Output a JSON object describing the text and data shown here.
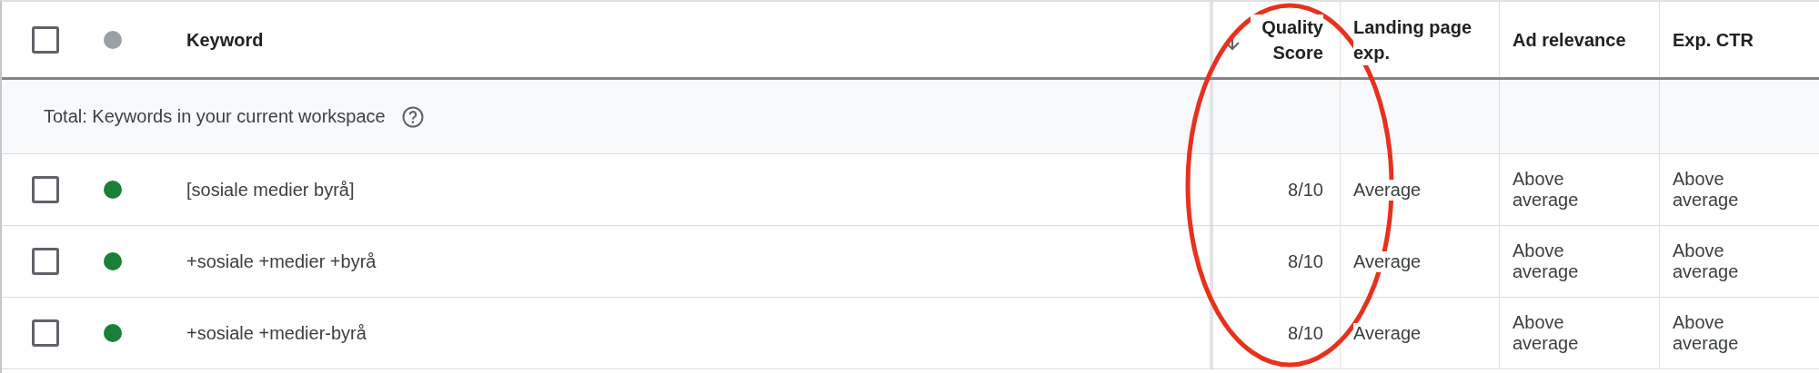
{
  "header": {
    "select_all": {
      "checked": false
    },
    "status_dot": {
      "color": "#9aa0a6"
    },
    "columns": [
      {
        "label": "Keyword",
        "sorted": false
      },
      {
        "label": "Quality Score",
        "sorted": true
      },
      {
        "label": "Landing page exp.",
        "sorted": false
      },
      {
        "label": "Ad relevance",
        "sorted": false
      },
      {
        "label": "Exp. CTR",
        "sorted": false
      }
    ]
  },
  "total_row": {
    "label": "Total: Keywords in your current workspace"
  },
  "rows": [
    {
      "checked": false,
      "color": "#188038",
      "keyword": "[sosiale medier byrå]",
      "quality_score": "8/10",
      "landing_page_exp": "Average",
      "ad_relevance": "Above average",
      "exp_ctr": "Above average"
    },
    {
      "checked": false,
      "color": "#188038",
      "keyword": "+sosiale +medier +byrå",
      "quality_score": "8/10",
      "landing_page_exp": "Average",
      "ad_relevance": "Above average",
      "exp_ctr": "Above average"
    },
    {
      "checked": false,
      "color": "#188038",
      "keyword": "+sosiale +medier-byrå",
      "quality_score": "8/10",
      "landing_page_exp": "Average",
      "ad_relevance": "Above average",
      "exp_ctr": "Above average"
    }
  ],
  "annotation": {
    "kind": "ellipse",
    "color": "#e8311c"
  }
}
